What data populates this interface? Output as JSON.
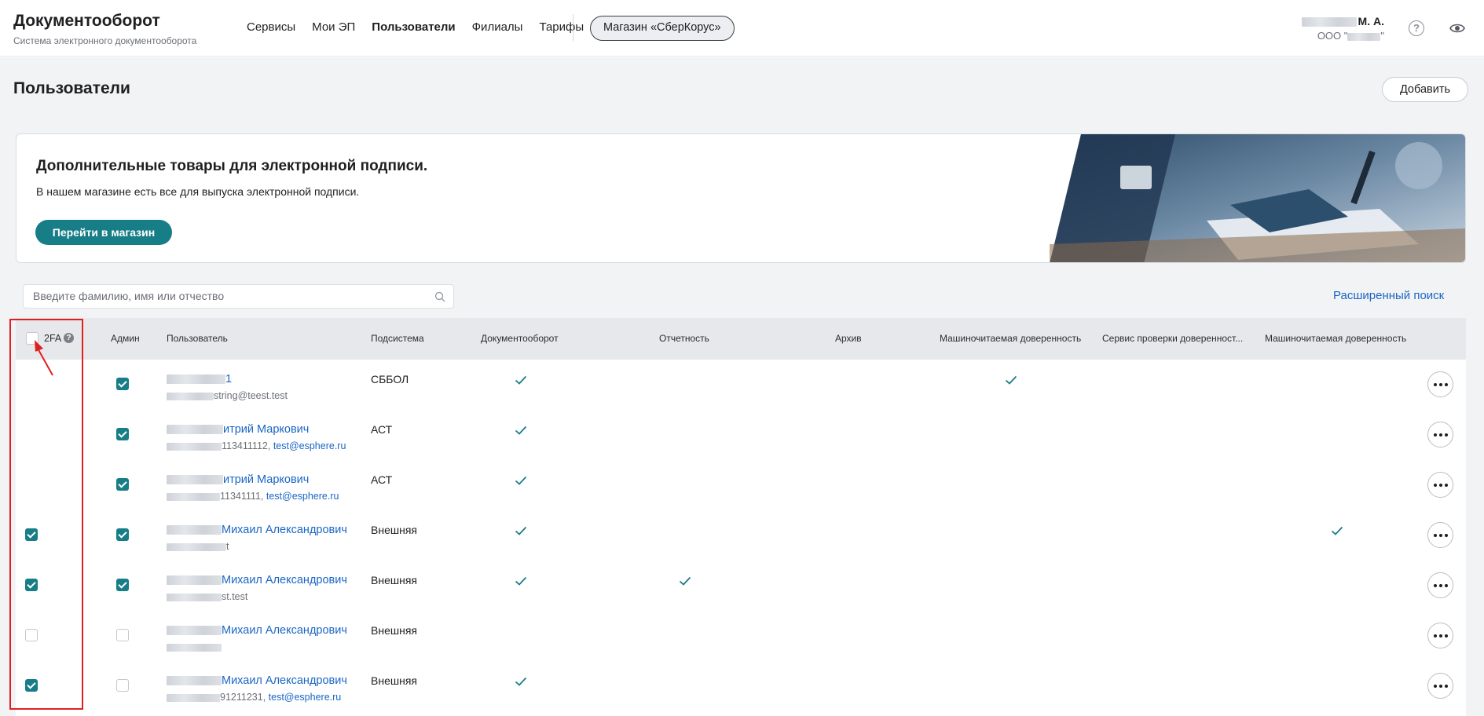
{
  "header": {
    "app_title": "Документооборот",
    "app_subtitle": "Система электронного документооборота",
    "nav": [
      {
        "label": "Сервисы",
        "active": false
      },
      {
        "label": "Мои ЭП",
        "active": false
      },
      {
        "label": "Пользователи",
        "active": true
      },
      {
        "label": "Филиалы",
        "active": false
      },
      {
        "label": "Тарифы",
        "active": false
      }
    ],
    "shop_button": "Магазин «СберКорус»",
    "user_name_suffix": "М. А.",
    "user_org_prefix": "ООО \"",
    "user_org_suffix": "\"",
    "help_glyph": "?"
  },
  "page": {
    "title": "Пользователи",
    "add_button": "Добавить"
  },
  "promo": {
    "title": "Дополнительные товары для электронной подписи.",
    "text": "В нашем магазине есть все для выпуска электронной подписи.",
    "button": "Перейти в магазин"
  },
  "search": {
    "placeholder": "Введите фамилию, имя или отчество",
    "advanced": "Расширенный поиск"
  },
  "table": {
    "columns": {
      "twofa": "2FA",
      "admin": "Админ",
      "user": "Пользователь",
      "subsystem": "Подсистема",
      "docflow": "Документооборот",
      "reporting": "Отчетность",
      "archive": "Архив",
      "mchd": "Машиночитаемая доверенность",
      "verify": "Сервис проверки доверенност...",
      "mchd2": "Машиночитаемая доверенность"
    },
    "rows": [
      {
        "twofa": null,
        "admin": true,
        "name_visible": "1",
        "detail_visible": "string@teest.test",
        "subsystem": "СББОЛ",
        "docflow": true,
        "reporting": false,
        "mchd": true,
        "mchd2": false
      },
      {
        "twofa": null,
        "admin": true,
        "name_visible": "итрий Маркович",
        "detail_visible": "113411112, ",
        "email": "test@esphere.ru",
        "subsystem": "АСТ",
        "docflow": true,
        "reporting": false,
        "mchd": false,
        "mchd2": false
      },
      {
        "twofa": null,
        "admin": true,
        "name_visible": "итрий Маркович",
        "detail_visible": "11341111, ",
        "email": "test@esphere.ru",
        "subsystem": "АСТ",
        "docflow": true,
        "reporting": false,
        "mchd": false,
        "mchd2": false
      },
      {
        "twofa": true,
        "admin": true,
        "name_visible": "Михаил Александрович",
        "detail_visible": "t",
        "subsystem": "Внешняя",
        "docflow": true,
        "reporting": false,
        "mchd": false,
        "mchd2": true
      },
      {
        "twofa": true,
        "admin": true,
        "name_visible": "Михаил Александрович",
        "detail_visible": "st.test",
        "subsystem": "Внешняя",
        "docflow": true,
        "reporting": true,
        "mchd": false,
        "mchd2": false
      },
      {
        "twofa": false,
        "admin": false,
        "name_visible": "Михаил Александрович",
        "detail_visible": "",
        "subsystem": "Внешняя",
        "docflow": false,
        "reporting": false,
        "mchd": false,
        "mchd2": false
      },
      {
        "twofa": true,
        "admin": false,
        "name_visible": "Михаил Александрович",
        "detail_visible": "91211231, ",
        "email": "test@esphere.ru",
        "subsystem": "Внешняя",
        "docflow": true,
        "reporting": false,
        "mchd": false,
        "mchd2": false
      }
    ]
  },
  "colors": {
    "accent": "#177d86",
    "link": "#1a66c4",
    "highlight": "#e02020"
  }
}
